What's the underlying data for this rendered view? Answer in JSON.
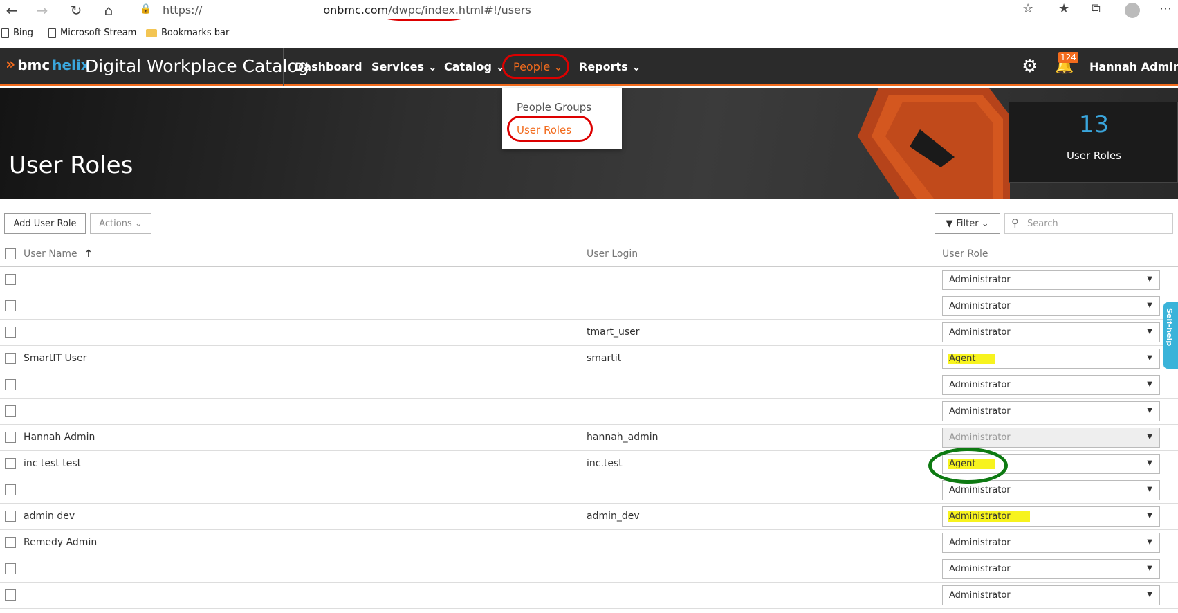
{
  "browser": {
    "url_prefix": "https://",
    "url_host": "onbmc.com",
    "url_path": "/dwpc/index.html#!/users",
    "bookmarks": [
      "Bing",
      "Microsoft Stream",
      "Bookmarks bar"
    ]
  },
  "app": {
    "logo_bmc": "bmc",
    "logo_helix": "helix",
    "title": "Digital Workplace Catalog",
    "nav": {
      "dashboard": "Dashboard",
      "services": "Services ⌄",
      "catalog": "Catalog ⌄",
      "people": "People ⌄",
      "reports": "Reports ⌄"
    },
    "notifications": "124",
    "user": "Hannah Admin ⌄",
    "brand_color": "#f26b1d",
    "accent_color": "#3aa6dd"
  },
  "people_menu": {
    "items": [
      "People Groups",
      "User Roles"
    ],
    "selected": "User Roles"
  },
  "banner": {
    "page_title": "User Roles",
    "stat_value": "13",
    "stat_label": "User Roles"
  },
  "toolbar": {
    "add_label": "Add User Role",
    "actions_label": "Actions ⌄",
    "filter_label": "Filter ⌄",
    "search_placeholder": "Search"
  },
  "table": {
    "headers": {
      "name": "User Name",
      "login": "User Login",
      "role": "User Role",
      "sort_icon": "↑"
    },
    "rows": [
      {
        "name": "",
        "login": "",
        "role": "Administrator",
        "highlight": false,
        "disabled": false
      },
      {
        "name": "",
        "login": "",
        "role": "Administrator",
        "highlight": false,
        "disabled": false
      },
      {
        "name": "",
        "login": "tmart_user",
        "role": "Administrator",
        "highlight": false,
        "disabled": false
      },
      {
        "name": "SmartIT User",
        "login": "smartit",
        "role": "Agent",
        "highlight": true,
        "disabled": false
      },
      {
        "name": "",
        "login": "",
        "role": "Administrator",
        "highlight": false,
        "disabled": false
      },
      {
        "name": "",
        "login": "",
        "role": "Administrator",
        "highlight": false,
        "disabled": false
      },
      {
        "name": "Hannah Admin",
        "login": "hannah_admin",
        "role": "Administrator",
        "highlight": false,
        "disabled": true
      },
      {
        "name": "inc test test",
        "login": "inc.test",
        "role": "Agent",
        "highlight": true,
        "disabled": false
      },
      {
        "name": "",
        "login": "",
        "role": "Administrator",
        "highlight": false,
        "disabled": false
      },
      {
        "name": "admin dev",
        "login": "admin_dev",
        "role": "Administrator",
        "highlight": true,
        "disabled": false
      },
      {
        "name": "Remedy Admin",
        "login": "",
        "role": "Administrator",
        "highlight": false,
        "disabled": false
      },
      {
        "name": "",
        "login": "",
        "role": "Administrator",
        "highlight": false,
        "disabled": false
      },
      {
        "name": "",
        "login": "",
        "role": "Administrator",
        "highlight": false,
        "disabled": false
      }
    ]
  },
  "self_help": "Self-help"
}
